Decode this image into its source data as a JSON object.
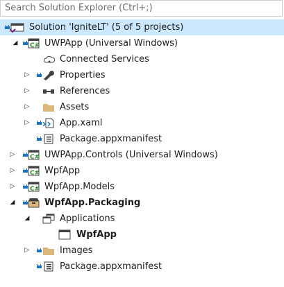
{
  "search": {
    "placeholder": "Search Solution Explorer (Ctrl+;)"
  },
  "tree": {
    "solution_label": "Solution 'IgniteLT' (5 of 5 projects)",
    "uwp_app": "UWPApp (Universal Windows)",
    "connected_services": "Connected Services",
    "properties": "Properties",
    "references": "References",
    "assets": "Assets",
    "app_xaml": "App.xaml",
    "package_manifest_uwp": "Package.appxmanifest",
    "uwp_controls": "UWPApp.Controls (Universal Windows)",
    "wpf_app": "WpfApp",
    "wpf_models": "WpfApp.Models",
    "wpf_packaging": "WpfApp.Packaging",
    "applications": "Applications",
    "wpf_app_ref": "WpfApp",
    "images": "Images",
    "package_manifest_pkg": "Package.appxmanifest"
  },
  "icons": {
    "solution": "solution-icon",
    "csharp_project": "csharp-project-icon",
    "cloud": "connected-services-icon",
    "wrench": "wrench-icon",
    "references": "references-icon",
    "folder": "folder-icon",
    "xaml": "xaml-icon",
    "manifest": "manifest-icon",
    "packaging": "packaging-project-icon",
    "applications": "applications-icon",
    "window": "window-icon",
    "lock": "lock-icon"
  },
  "colors": {
    "selection": "#cce8ff",
    "lock_blue": "#1a74c4",
    "folder": "#dcb67a",
    "csharp_green": "#388a34"
  }
}
